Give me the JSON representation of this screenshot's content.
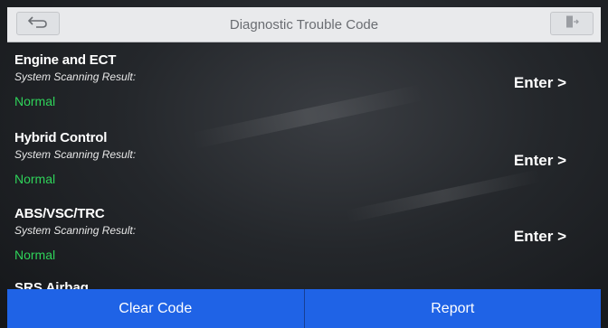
{
  "header": {
    "title": "Diagnostic Trouble Code",
    "back_icon": "back-arrow-icon",
    "exit_icon": "exit-icon"
  },
  "systems": [
    {
      "name": "Engine and ECT",
      "scan_label": "System Scanning Result:",
      "status": "Normal",
      "action": "Enter >"
    },
    {
      "name": "Hybrid Control",
      "scan_label": "System Scanning Result:",
      "status": "Normal",
      "action": "Enter >"
    },
    {
      "name": "ABS/VSC/TRC",
      "scan_label": "System Scanning Result:",
      "status": "Normal",
      "action": "Enter >"
    }
  ],
  "partial_item": {
    "name": "SRS Airbag"
  },
  "footer": {
    "clear_label": "Clear Code",
    "report_label": "Report"
  },
  "colors": {
    "status_normal": "#2fd35a",
    "button_blue": "#1f63e6",
    "header_bg": "#e9eaec"
  }
}
